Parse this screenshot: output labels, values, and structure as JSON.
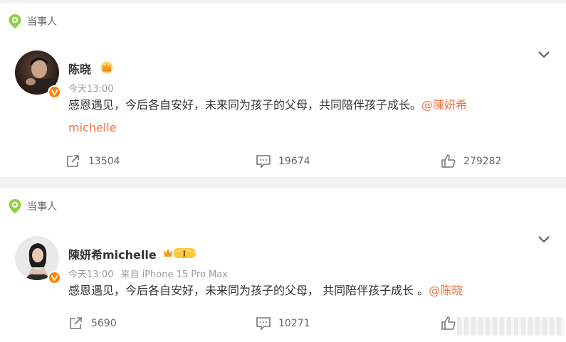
{
  "posts": [
    {
      "tag_label": "当事人",
      "author": "陈晓",
      "timestamp": "今天13:00",
      "source": "",
      "text_main": "感恩遇见，今后各自安好，未来同为孩子的父母，共同陪伴孩子成长。",
      "mention_line1": "@陳妍希",
      "mention_line2": "michelle",
      "reposts": "13504",
      "comments": "19674",
      "likes": "279282",
      "badge_icon": "crown-icon"
    },
    {
      "tag_label": "当事人",
      "author": "陳妍希michelle",
      "timestamp": "今天13:00",
      "source": "来自 iPhone 15 Pro Max",
      "text_main": "感恩遇见，今后各自安好，未来同为孩子的父母， 共同陪伴孩子成长 。",
      "mention": "@陈晓",
      "reposts": "5690",
      "comments": "10271",
      "badge_icon": "vip-level-icon",
      "vip_level": "I"
    }
  ],
  "colors": {
    "accent": "#eb7340",
    "verified": "#ff8200",
    "tag_green": "#8fcf43",
    "background": "#f2f2f2"
  }
}
